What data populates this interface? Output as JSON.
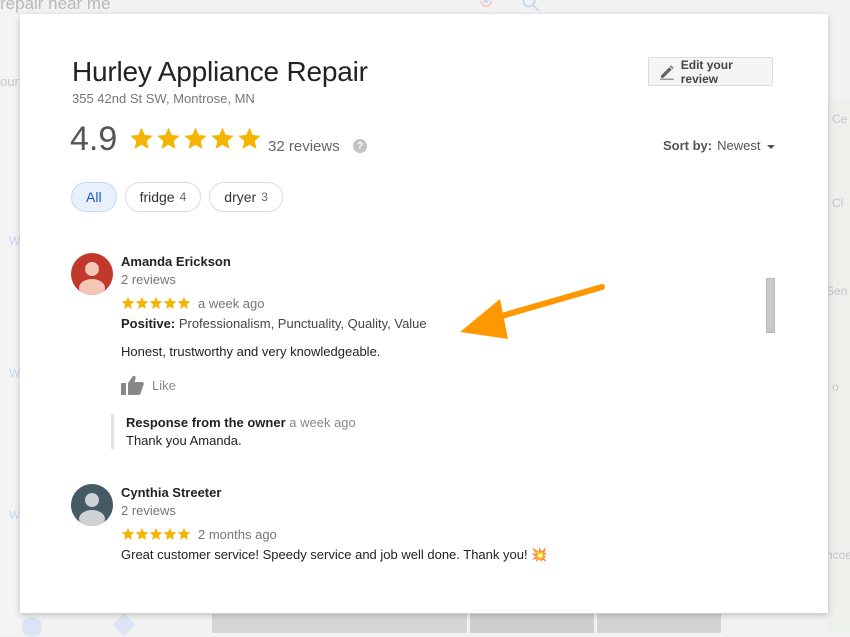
{
  "background": {
    "search_query": "repair near me",
    "left_fragment": "our",
    "left_letters": [
      "W",
      "W",
      "W"
    ],
    "map_labels": [
      "Ce",
      "Cl",
      "Sen",
      "o",
      "ncoe"
    ]
  },
  "modal": {
    "business_name": "Hurley Appliance Repair",
    "address": "355 42nd St SW, Montrose, MN",
    "edit_review_label": "Edit your review",
    "edit_icon": "pencil-icon",
    "rating": "4.9",
    "rating_stars": 5,
    "review_count_label": "32 reviews",
    "help_icon": "?",
    "sort": {
      "label": "Sort by:",
      "value": "Newest"
    },
    "filters": [
      {
        "label": "All",
        "count": "",
        "active": true
      },
      {
        "label": "fridge",
        "count": "4",
        "active": false
      },
      {
        "label": "dryer",
        "count": "3",
        "active": false
      }
    ],
    "scroll_position": 0.35
  },
  "reviews": [
    {
      "name": "Amanda Erickson",
      "sub": "2 reviews",
      "stars": 5,
      "time": "a week ago",
      "positive_label": "Positive:",
      "positive_items": "Professionalism, Punctuality, Quality, Value",
      "text": "Honest, trustworthy and very knowledgeable.",
      "like_label": "Like",
      "avatar_color": "#c0392b",
      "owner_response": {
        "header": "Response from the owner",
        "time": "a week ago",
        "text": "Thank you Amanda."
      }
    },
    {
      "name": "Cynthia Streeter",
      "sub": "2 reviews",
      "stars": 5,
      "time": "2 months ago",
      "text": "Great customer service! Speedy service and job well done. Thank you! 💥",
      "avatar_color": "#455a64"
    }
  ],
  "annotation": {
    "type": "arrow",
    "color": "#ff9800",
    "points_to": "positive-attributes"
  },
  "colors": {
    "star": "#f4b400",
    "accent_blue": "#1a56c8"
  }
}
